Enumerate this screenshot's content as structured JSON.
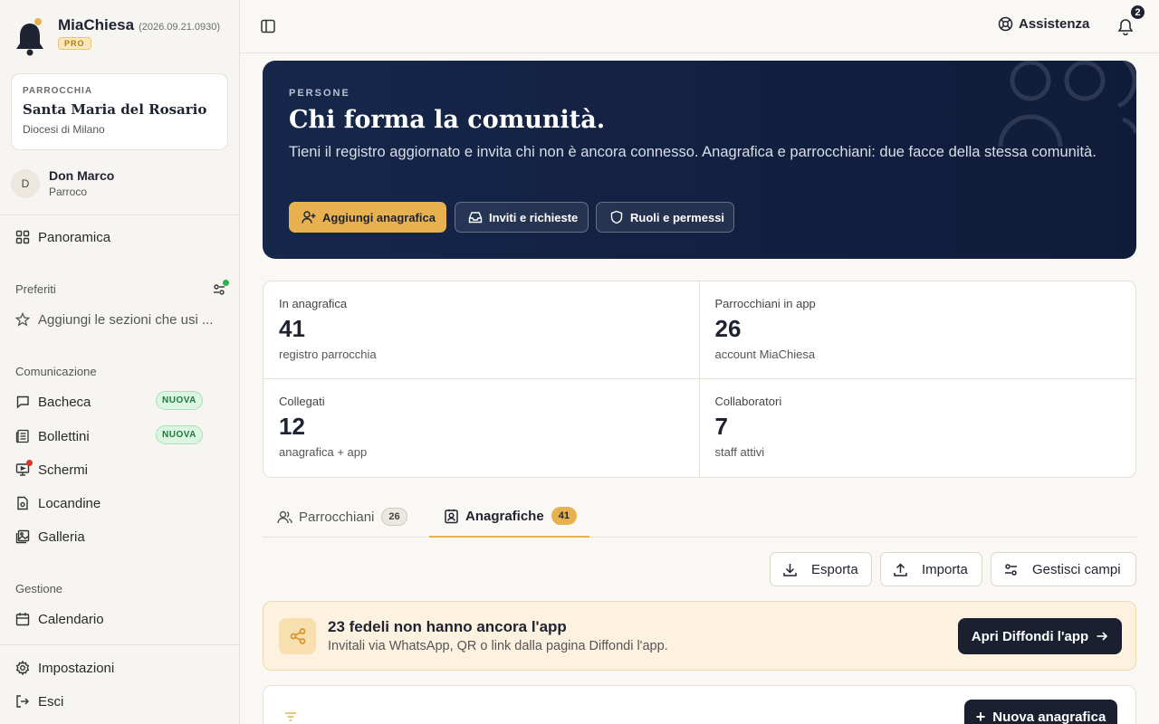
{
  "brand": {
    "name": "MiaChiesa",
    "version": "(2026.09.21.0930)",
    "plan": "PRO"
  },
  "parish": {
    "kicker": "PARROCCHIA",
    "name": "Santa Maria del Rosario",
    "diocese": "Diocesi di Milano"
  },
  "user": {
    "initial": "D",
    "name": "Don Marco",
    "role": "Parroco"
  },
  "nav": {
    "overview": "Panoramica",
    "favorites_label": "Preferiti",
    "favorites_hint": "Aggiungi le sezioni che usi ...",
    "communication_label": "Comunicazione",
    "communication_items": [
      {
        "label": "Bacheca",
        "badge": "NUOVA"
      },
      {
        "label": "Bollettini",
        "badge": "NUOVA"
      },
      {
        "label": "Schermi"
      },
      {
        "label": "Locandine"
      },
      {
        "label": "Galleria"
      }
    ],
    "management_label": "Gestione",
    "calendar": "Calendario",
    "settings": "Impostazioni",
    "logout": "Esci"
  },
  "topbar": {
    "help": "Assistenza",
    "notifications_count": "2"
  },
  "hero": {
    "kicker": "PERSONE",
    "title": "Chi forma la comunità.",
    "description": "Tieni il registro aggiornato e invita chi non è ancora connesso. Anagrafica e parrocchiani: due facce della stessa comunità.",
    "buttons": {
      "add": "Aggiungi anagrafica",
      "invites": "Inviti e richieste",
      "roles": "Ruoli e permessi"
    }
  },
  "stats": [
    {
      "label": "In anagrafica",
      "value": "41",
      "sub": "registro parrocchia"
    },
    {
      "label": "Parrocchiani in app",
      "value": "26",
      "sub": "account MiaChiesa"
    },
    {
      "label": "Collegati",
      "value": "12",
      "sub": "anagrafica + app"
    },
    {
      "label": "Collaboratori",
      "value": "7",
      "sub": "staff attivi"
    }
  ],
  "tabs": [
    {
      "label": "Parrocchiani",
      "count": "26"
    },
    {
      "label": "Anagrafiche",
      "count": "41"
    }
  ],
  "toolbar": {
    "export": "Esporta",
    "import": "Importa",
    "manage_fields": "Gestisci campi"
  },
  "banner": {
    "title": "23 fedeli non hanno ancora l'app",
    "subtitle": "Invitali via WhatsApp, QR o link dalla pagina Diffondi l'app.",
    "cta": "Apri Diffondi l'app"
  },
  "list": {
    "new_button": "Nuova anagrafica"
  },
  "colors": {
    "accent": "#e8b14f",
    "navy": "#16274a",
    "dark_button": "#1a2030",
    "new_badge": "#1f7a3b"
  }
}
